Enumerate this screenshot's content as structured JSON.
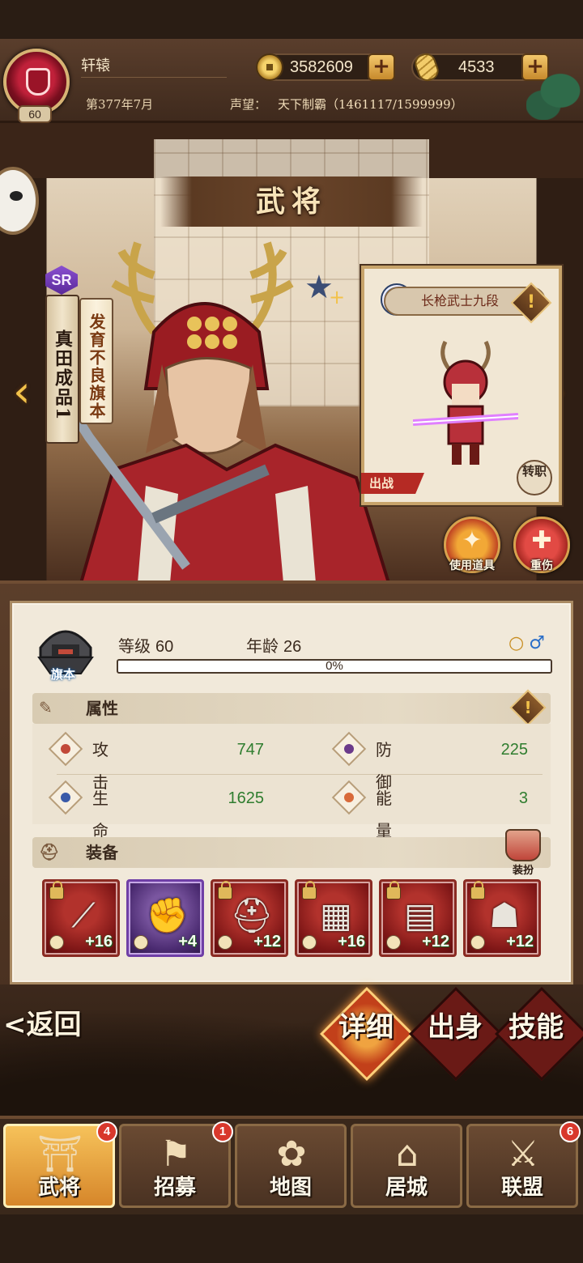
{
  "player": {
    "name": "轩辕",
    "level": "60",
    "gold": "3582609",
    "tallies": "4533",
    "date": "第377年7月",
    "fame_label": "声望：",
    "fame_value": "天下制霸（1461117/1599999）"
  },
  "page_title": "武将",
  "general": {
    "rarity": "SR",
    "name": "真田成品1",
    "title": "发育不良旗本",
    "rank": "旗本",
    "level_label": "等级",
    "level": "60",
    "age_label": "年龄",
    "age": "26",
    "exp_progress": 0,
    "exp_label": "0%"
  },
  "unit_card": {
    "name": "长枪武士九段",
    "sortie_label": "出战",
    "transfer_label": "转职"
  },
  "actions": {
    "use_item": "使用道具",
    "heavy_wound": "重伤"
  },
  "attributes": {
    "section_label": "属性",
    "attack_label": "攻击",
    "attack": "747",
    "defense_label": "防御",
    "defense": "225",
    "hp_label": "生命",
    "hp": "1625",
    "energy_label": "能量",
    "energy": "3"
  },
  "equipment": {
    "section_label": "装备",
    "dress_label": "装扮",
    "slots": [
      {
        "icon": "spear-head-icon",
        "bonus": "+16",
        "quality": "red",
        "locked": true
      },
      {
        "icon": "gauntlet-icon",
        "bonus": "+4",
        "quality": "purple",
        "locked": false
      },
      {
        "icon": "kabuto-helmet-icon",
        "bonus": "+12",
        "quality": "red",
        "locked": true
      },
      {
        "icon": "armor-icon",
        "bonus": "+16",
        "quality": "red",
        "locked": true
      },
      {
        "icon": "skirt-armor-icon",
        "bonus": "+12",
        "quality": "red",
        "locked": true
      },
      {
        "icon": "tabi-socks-icon",
        "bonus": "+12",
        "quality": "red",
        "locked": true
      }
    ]
  },
  "detail_tabs": {
    "back": "<返回",
    "detail": "详细",
    "origin": "出身",
    "skill": "技能"
  },
  "bottom_nav": [
    {
      "label": "武将",
      "badge": "4"
    },
    {
      "label": "招募",
      "badge": "1"
    },
    {
      "label": "地图",
      "badge": ""
    },
    {
      "label": "居城",
      "badge": ""
    },
    {
      "label": "联盟",
      "badge": "6"
    }
  ],
  "colors": {
    "accent_gold": "#d9a23a",
    "stat_value_green": "#2f7d2f",
    "sr_purple": "#8a4fd0",
    "badge_red": "#d8382c"
  }
}
